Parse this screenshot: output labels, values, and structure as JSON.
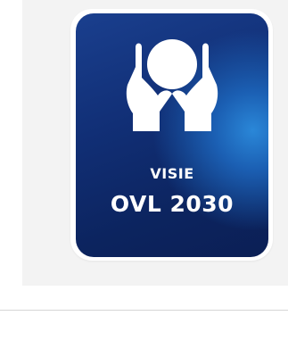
{
  "logo": {
    "line1": "VISIE",
    "line2": "OVL 2030",
    "icon": "hands-holding-circle-icon",
    "colors": {
      "badge_dark": "#0c245f",
      "badge_mid": "#112f76",
      "badge_glow": "#2a87d8",
      "text": "#ffffff",
      "panel": "#f3f3f3",
      "divider": "#d5d5d5"
    }
  }
}
